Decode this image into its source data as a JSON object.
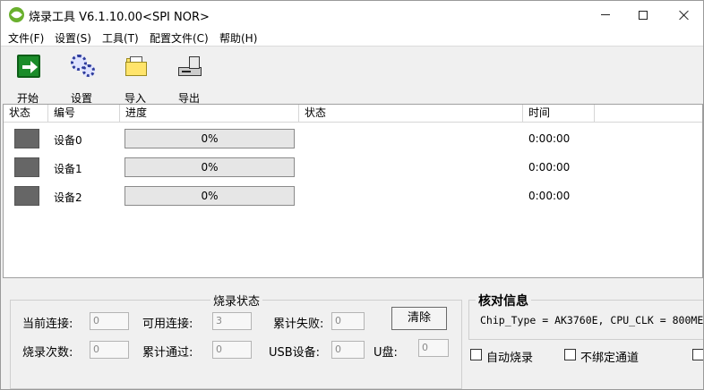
{
  "window": {
    "title": "烧录工具 V6.1.10.00<SPI NOR>"
  },
  "menu": [
    "文件(F)",
    "设置(S)",
    "工具(T)",
    "配置文件(C)",
    "帮助(H)"
  ],
  "toolbar": {
    "start": "开始",
    "settings": "设置",
    "import": "导入",
    "export": "导出"
  },
  "columns": [
    "状态",
    "编号",
    "进度",
    "状态",
    "时间"
  ],
  "devices": [
    {
      "name": "设备0",
      "progress": 0,
      "progress_text": "0%",
      "status": "",
      "time": "0:00:00"
    },
    {
      "name": "设备1",
      "progress": 0,
      "progress_text": "0%",
      "status": "",
      "time": "0:00:00"
    },
    {
      "name": "设备2",
      "progress": 0,
      "progress_text": "0%",
      "status": "",
      "time": "0:00:00"
    }
  ],
  "burn_status": {
    "title": "烧录状态",
    "current_connections_label": "当前连接:",
    "current_connections": "0",
    "available_connections_label": "可用连接:",
    "available_connections": "3",
    "total_failed_label": "累计失败:",
    "total_failed": "0",
    "burn_count_label": "烧录次数:",
    "burn_count": "0",
    "total_passed_label": "累计通过:",
    "total_passed": "0",
    "usb_devices_label": "USB设备:",
    "usb_devices": "0",
    "udisk_label": "U盘:",
    "udisk": "0",
    "clear_button": "清除"
  },
  "verify": {
    "title": "核对信息",
    "text": "Chip_Type = AK3760E, CPU_CLK = 800ME"
  },
  "options": {
    "auto_burn": "自动烧录",
    "unbound_channel": "不绑定通道"
  },
  "colors": {
    "indicator": "#666666",
    "progress_track": "#e6e6e6",
    "progress_fill": "#06b025",
    "app_icon": "#6ab02e",
    "start_icon": "#1b8c2a"
  }
}
